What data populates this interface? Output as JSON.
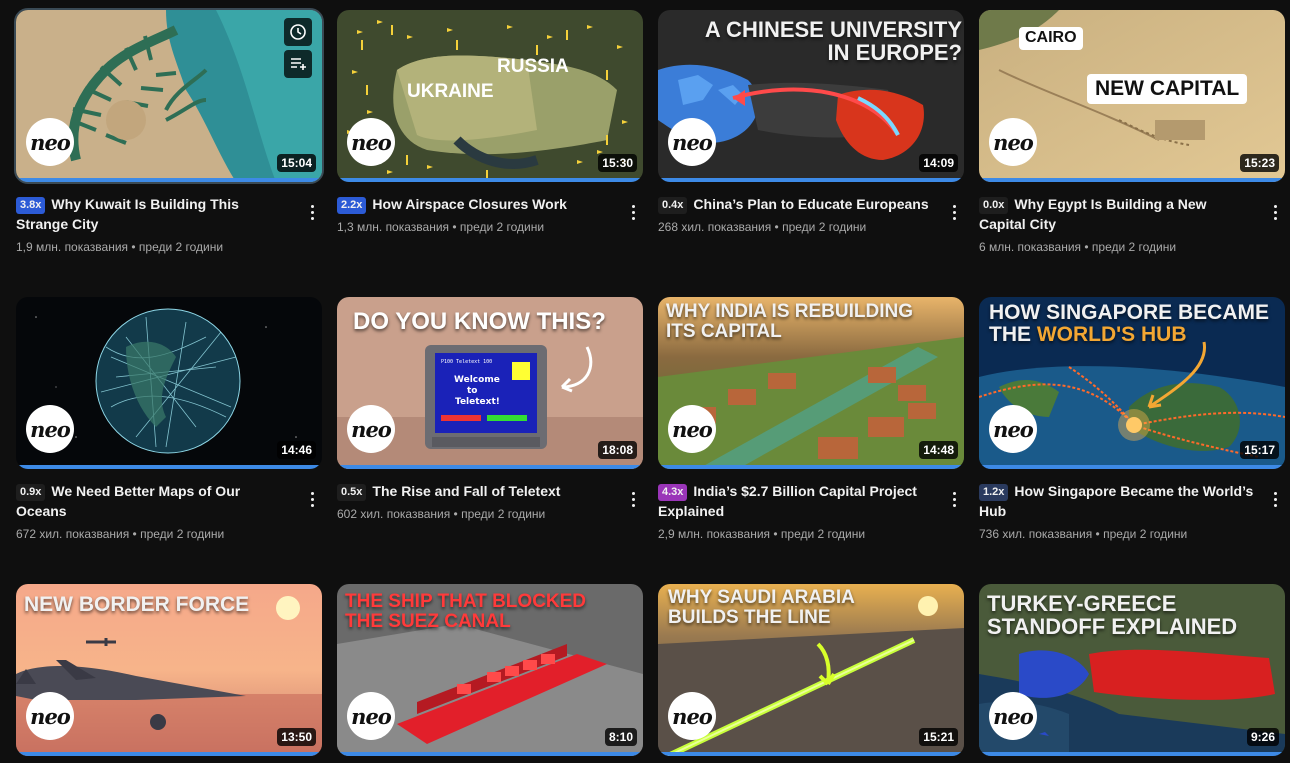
{
  "colors": {
    "progress": "#3d8ae6",
    "background": "#0f0f0f",
    "text_secondary": "#aaaaaa"
  },
  "hover_actions": [
    "watch-later-icon",
    "add-to-queue-icon"
  ],
  "videos": [
    {
      "speed": "3.8x",
      "speed_bg": "#2c5bd6",
      "speed_color": "#ffffff",
      "title": "Why Kuwait Is Building This Strange City",
      "stats": "1,9 млн. показвания • преди 2 години",
      "duration": "15:04",
      "logo": "neo"
    },
    {
      "speed": "2.2x",
      "speed_bg": "#2c5bd6",
      "speed_color": "#ffffff",
      "title": "How Airspace Closures Work",
      "stats": "1,3 млн. показвания • преди 2 години",
      "duration": "15:30",
      "logo": "neo",
      "overlay": [
        "RUSSIA",
        "UKRAINE"
      ]
    },
    {
      "speed": "0.4x",
      "speed_bg": "#1e1e1e",
      "speed_color": "#ffffff",
      "title": "China’s Plan to Educate Europeans",
      "stats": "268 хил. показвания • преди 2 години",
      "duration": "14:09",
      "logo": "neo",
      "overlay": [
        "A CHINESE UNIVERSITY",
        "IN EUROPE?"
      ]
    },
    {
      "speed": "0.0x",
      "speed_bg": "#1e1e1e",
      "speed_color": "#ffffff",
      "title": "Why Egypt Is Building a New Capital City",
      "stats": "6 млн. показвания • преди 2 години",
      "duration": "15:23",
      "logo": "neo",
      "overlay": [
        "CAIRO",
        "NEW CAPITAL"
      ]
    },
    {
      "speed": "0.9x",
      "speed_bg": "#1e1e1e",
      "speed_color": "#ffffff",
      "title": "We Need Better Maps of Our Oceans",
      "stats": "672 хил. показвания • преди 2 години",
      "duration": "14:46",
      "logo": "neo"
    },
    {
      "speed": "0.5x",
      "speed_bg": "#1e1e1e",
      "speed_color": "#ffffff",
      "title": "The Rise and Fall of Teletext",
      "stats": "602 хил. показвания • преди 2 години",
      "duration": "18:08",
      "logo": "neo",
      "overlay": [
        "DO YOU KNOW THIS?"
      ]
    },
    {
      "speed": "4.3x",
      "speed_bg": "#9a35b8",
      "speed_color": "#ffffff",
      "title": "India’s $2.7 Billion Capital Project Explained",
      "stats": "2,9 млн. показвания • преди 2 години",
      "duration": "14:48",
      "logo": "neo",
      "overlay": [
        "WHY INDIA IS REBUILDING",
        "ITS CAPITAL"
      ]
    },
    {
      "speed": "1.2x",
      "speed_bg": "#2a3a5e",
      "speed_color": "#ffffff",
      "title": "How Singapore Became the World’s Hub",
      "stats": "736 хил. показвания • преди 2 години",
      "duration": "15:17",
      "logo": "neo",
      "overlay": [
        "HOW SINGAPORE BECAME",
        "THE",
        "WORLD'S HUB"
      ]
    },
    {
      "duration": "13:50",
      "logo": "neo",
      "overlay": [
        "NEW BORDER FORCE"
      ]
    },
    {
      "duration": "8:10",
      "logo": "neo",
      "overlay": [
        "THE SHIP THAT BLOCKED",
        "THE SUEZ CANAL"
      ]
    },
    {
      "duration": "15:21",
      "logo": "neo",
      "overlay": [
        "WHY SAUDI ARABIA",
        "BUILDS THE LINE"
      ]
    },
    {
      "duration": "9:26",
      "logo": "neo",
      "overlay": [
        "TURKEY-GREECE",
        "STANDOFF EXPLAINED"
      ]
    }
  ]
}
